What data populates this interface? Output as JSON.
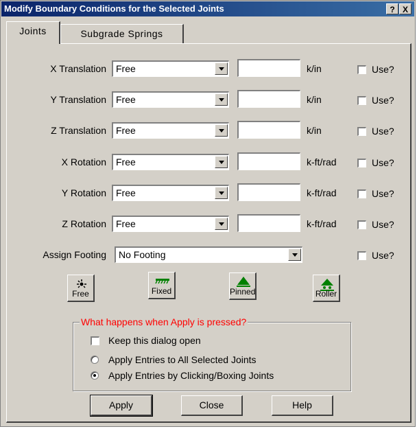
{
  "window": {
    "title": "Modify Boundary Conditions for the Selected Joints",
    "help_btn": "?",
    "close_btn": "X"
  },
  "tabs": [
    {
      "label": "Joints"
    },
    {
      "label": "Subgrade Springs"
    }
  ],
  "rows": [
    {
      "label": "X Translation",
      "value": "Free",
      "unit": "k/in",
      "use": "Use?"
    },
    {
      "label": "Y Translation",
      "value": "Free",
      "unit": "k/in",
      "use": "Use?"
    },
    {
      "label": "Z Translation",
      "value": "Free",
      "unit": "k/in",
      "use": "Use?"
    },
    {
      "label": "X Rotation",
      "value": "Free",
      "unit": "k-ft/rad",
      "use": "Use?"
    },
    {
      "label": "Y Rotation",
      "value": "Free",
      "unit": "k-ft/rad",
      "use": "Use?"
    },
    {
      "label": "Z Rotation",
      "value": "Free",
      "unit": "k-ft/rad",
      "use": "Use?"
    }
  ],
  "footing": {
    "label": "Assign Footing",
    "value": "No Footing",
    "use": "Use?"
  },
  "presets": [
    {
      "label": "Free"
    },
    {
      "label": "Fixed"
    },
    {
      "label": "Pinned"
    },
    {
      "label": "Roller"
    }
  ],
  "apply_group": {
    "title": "What happens when Apply is pressed?",
    "keep_open": "Keep this dialog open",
    "radio_all": "Apply Entries to All Selected Joints",
    "radio_click": "Apply Entries by Clicking/Boxing Joints"
  },
  "buttons": {
    "apply": "Apply",
    "close": "Close",
    "help": "Help"
  }
}
